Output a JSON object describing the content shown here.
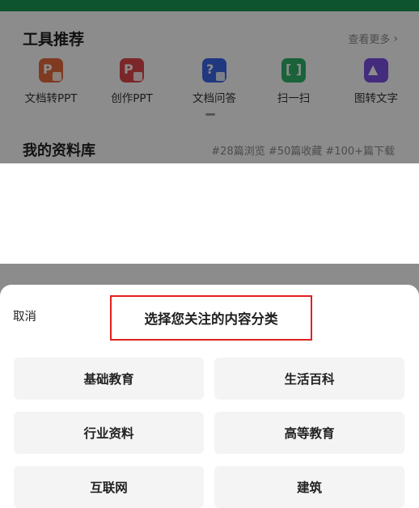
{
  "tools": {
    "title": "工具推荐",
    "more": "查看更多",
    "items": [
      {
        "label": "文档转PPT",
        "icon": "ppt-convert-icon",
        "color": "#e86a3e"
      },
      {
        "label": "创作PPT",
        "icon": "ppt-create-icon",
        "color": "#e0484c"
      },
      {
        "label": "文档问答",
        "icon": "doc-qa-icon",
        "color": "#3a67e8"
      },
      {
        "label": "扫一扫",
        "icon": "scan-icon",
        "color": "#2fb36b"
      },
      {
        "label": "图转文字",
        "icon": "image-to-text-icon",
        "color": "#7b4fe3"
      }
    ]
  },
  "library": {
    "title": "我的资料库",
    "stats": "#28篇浏览 #50篇收藏 #100+篇下载"
  },
  "sheet": {
    "cancel": "取消",
    "title": "选择您关注的内容分类",
    "categories": [
      "基础教育",
      "生活百科",
      "行业资料",
      "高等教育",
      "互联网",
      "建筑"
    ]
  },
  "colors": {
    "brand_green": "#1a9a55",
    "highlight_border": "#e02020"
  }
}
